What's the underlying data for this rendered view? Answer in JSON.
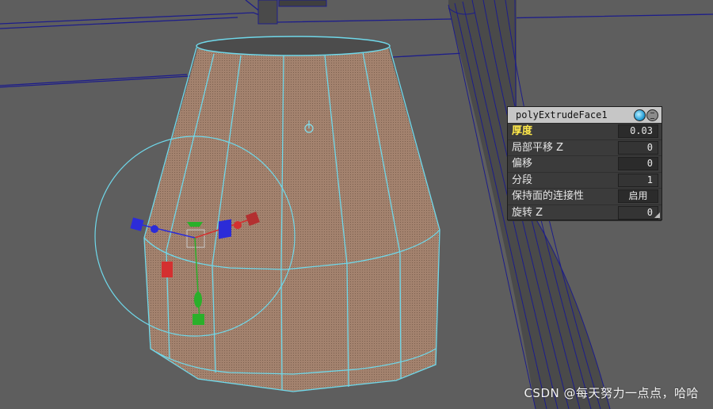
{
  "attribute_editor": {
    "title": "polyExtrudeFace1",
    "rows": [
      {
        "label": "厚度",
        "value": "0.03",
        "active": true
      },
      {
        "label": "局部平移 Z",
        "value": "0"
      },
      {
        "label": "偏移",
        "value": "0"
      },
      {
        "label": "分段",
        "value": "1"
      },
      {
        "label": "保持面的连接性",
        "value": "启用"
      },
      {
        "label": "旋转 Z",
        "value": "0"
      }
    ]
  },
  "scene": {
    "background_color": "#5e5e5e",
    "mesh_color": "#a3826e",
    "wire_color": "#6fd8ea",
    "dark_wire_color": "#1d1d8a",
    "manipulator": {
      "x_color": "#d43030",
      "y_color": "#2ab02a",
      "z_color": "#2c2cd8"
    }
  },
  "watermark": "CSDN @每天努力一点点，哈哈"
}
